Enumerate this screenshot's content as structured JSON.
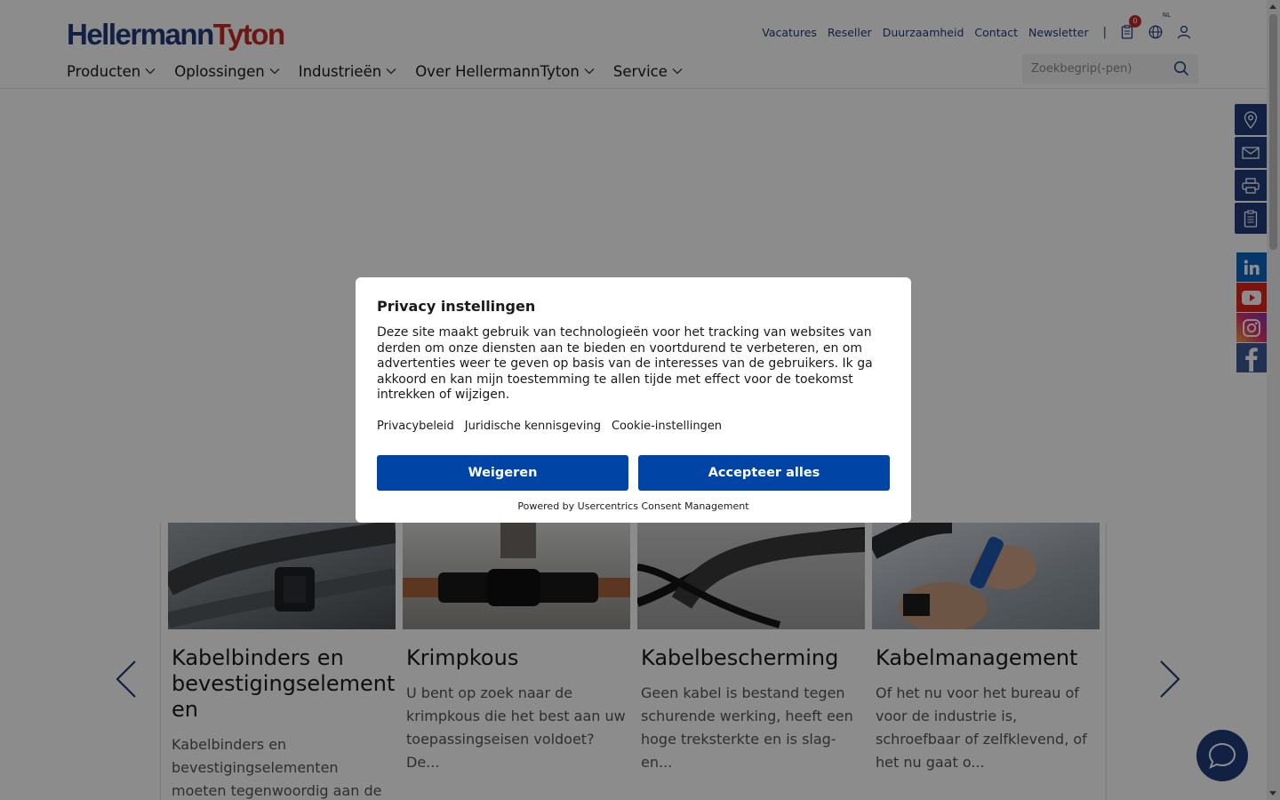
{
  "brand": {
    "part1": "Hellermann",
    "part2": "Tyton"
  },
  "topnav": {
    "links": [
      "Vacatures",
      "Reseller",
      "Duurzaamheid",
      "Contact",
      "Newsletter"
    ],
    "separator": "|",
    "cart_count": "0",
    "language": "NL"
  },
  "mainnav": {
    "items": [
      "Producten",
      "Oplossingen",
      "Industrieën",
      "Over HellermannTyton",
      "Service"
    ]
  },
  "search": {
    "placeholder": "Zoekbegrip(-pen)"
  },
  "cards": [
    {
      "title": "Kabelbinders en bevestigingselement en",
      "text": "Kabelbinders en bevestigingselementen moeten tegenwoordig aan de meest..."
    },
    {
      "title": "Krimpkous",
      "text": "U bent op zoek naar de krimpkous die het best aan uw toepassingseisen voldoet? De..."
    },
    {
      "title": "Kabelbescherming",
      "text": "Geen kabel is bestand tegen schurende werking, heeft een hoge treksterkte en is slag- en..."
    },
    {
      "title": "Kabelmanagement",
      "text": "Of het nu voor het bureau of voor de industrie is, schroefbaar of zelfklevend, of het nu gaat o..."
    }
  ],
  "consent": {
    "title": "Privacy instellingen",
    "description": "Deze site maakt gebruik van technologieën voor het tracking van websites van derden om onze diensten aan te bieden en voortdurend te verbeteren, en om advertenties weer te geven op basis van de interesses van de gebruikers. Ik ga akkoord en kan mijn toestemming te allen tijde met effect voor de toekomst intrekken of wijzigen.",
    "links": [
      "Privacybeleid",
      "Juridische kennisgeving",
      "Cookie-instellingen"
    ],
    "reject_label": "Weigeren",
    "accept_label": "Accepteer alles",
    "powered_by": "Powered by Usercentrics Consent Management"
  },
  "colors": {
    "brand_blue": "#1f3b7a",
    "brand_red": "#c42a26",
    "button_blue": "#0045a5"
  },
  "icons": {
    "side": [
      "location-icon",
      "mail-icon",
      "print-icon",
      "clipboard-icon"
    ],
    "social": [
      "linkedin-icon",
      "youtube-icon",
      "instagram-icon",
      "facebook-icon"
    ]
  }
}
